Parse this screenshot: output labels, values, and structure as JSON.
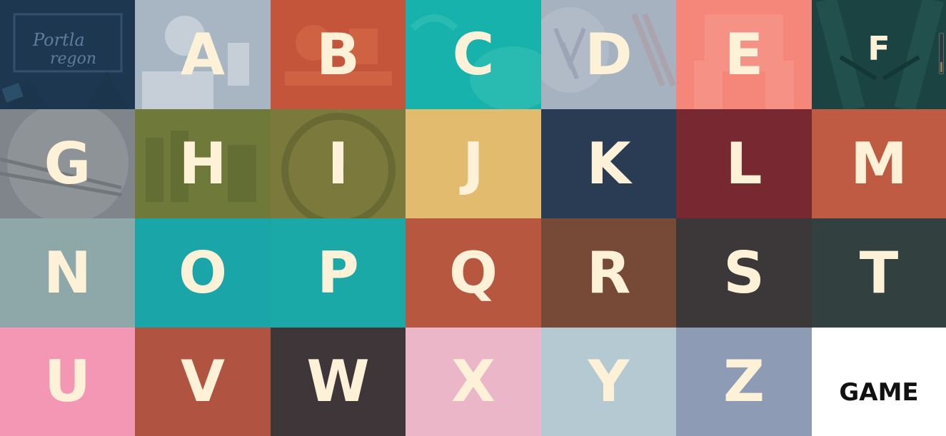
{
  "tiles": [
    {
      "letter": "A",
      "color": "#a8b6c4",
      "illustration": "person-drinking-icon"
    },
    {
      "letter": "B",
      "color": "#c5553a",
      "illustration": "breakfast-plate-icon"
    },
    {
      "letter": "C",
      "color": "#16b2ab",
      "illustration": "crab-icon"
    },
    {
      "letter": "D",
      "color": "#a7b2c1",
      "illustration": "seaweed-bacon-icon"
    },
    {
      "letter": "E",
      "color": "#f5877a",
      "illustration": "book-reading-icon"
    },
    {
      "letter": "F",
      "color": "#1a4342",
      "illustration": "fork-hands-icon"
    },
    {
      "letter": "G",
      "color": "#7f858a",
      "illustration": "chopsticks-plate-icon"
    },
    {
      "letter": "H",
      "color": "#6f7a3a",
      "illustration": "beer-bottles-icon"
    },
    {
      "letter": "I",
      "color": "#7b7a3c",
      "illustration": "unicycle-wheel-icon"
    },
    {
      "letter": "J",
      "color": "#e2bb6f",
      "illustration": ""
    },
    {
      "letter": "K",
      "color": "#2a3c53",
      "illustration": ""
    },
    {
      "letter": "L",
      "color": "#782830",
      "illustration": ""
    },
    {
      "letter": "M",
      "color": "#be5b42",
      "illustration": ""
    },
    {
      "letter": "N",
      "color": "#8ea7a9",
      "illustration": ""
    },
    {
      "letter": "O",
      "color": "#1aa6a8",
      "illustration": ""
    },
    {
      "letter": "P",
      "color": "#1aa9a6",
      "illustration": ""
    },
    {
      "letter": "Q",
      "color": "#b8573f",
      "illustration": ""
    },
    {
      "letter": "R",
      "color": "#764a36",
      "illustration": ""
    },
    {
      "letter": "S",
      "color": "#3c3739",
      "illustration": ""
    },
    {
      "letter": "T",
      "color": "#334040",
      "illustration": ""
    },
    {
      "letter": "U",
      "color": "#f497b5",
      "illustration": ""
    },
    {
      "letter": "V",
      "color": "#b05340",
      "illustration": ""
    },
    {
      "letter": "W",
      "color": "#3f3639",
      "illustration": ""
    },
    {
      "letter": "X",
      "color": "#ebb6c8",
      "illustration": ""
    },
    {
      "letter": "Y",
      "color": "#b4c9d2",
      "illustration": ""
    },
    {
      "letter": "Z",
      "color": "#8d9bb4",
      "illustration": ""
    }
  ],
  "first_tile": {
    "color": "#203a52",
    "illustration": "portland-oregon-sign-icon",
    "sign_text_1": "Portla",
    "sign_text_2": "regon"
  },
  "game_tile": {
    "label": "GAME",
    "color": "#ffffff"
  }
}
